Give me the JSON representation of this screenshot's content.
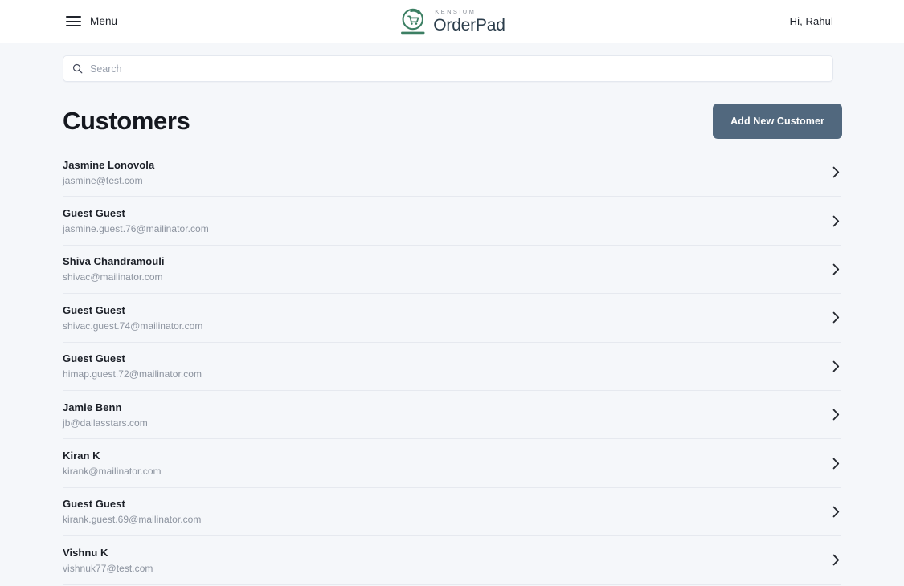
{
  "header": {
    "menu_label": "Menu",
    "menu_icon": "hamburger-icon",
    "logo": {
      "brand_small": "KENSIUM",
      "brand_main": "OrderPad",
      "icon": "cart-refresh-circle-icon",
      "color": "#3c7f63"
    },
    "greeting": "Hi, Rahul"
  },
  "search": {
    "placeholder": "Search",
    "value": "",
    "icon": "search-icon"
  },
  "main": {
    "title": "Customers",
    "add_button_label": "Add New Customer",
    "add_button_color": "#51687e",
    "row_chevron_icon": "chevron-right-icon",
    "customers": [
      {
        "name": "Jasmine Lonovola",
        "email": "jasmine@test.com"
      },
      {
        "name": "Guest Guest",
        "email": "jasmine.guest.76@mailinator.com"
      },
      {
        "name": "Shiva Chandramouli",
        "email": "shivac@mailinator.com"
      },
      {
        "name": "Guest Guest",
        "email": "shivac.guest.74@mailinator.com"
      },
      {
        "name": "Guest Guest",
        "email": "himap.guest.72@mailinator.com"
      },
      {
        "name": "Jamie Benn",
        "email": "jb@dallasstars.com"
      },
      {
        "name": "Kiran K",
        "email": "kirank@mailinator.com"
      },
      {
        "name": "Guest Guest",
        "email": "kirank.guest.69@mailinator.com"
      },
      {
        "name": "Vishnu K",
        "email": "vishnuk77@test.com"
      }
    ]
  }
}
